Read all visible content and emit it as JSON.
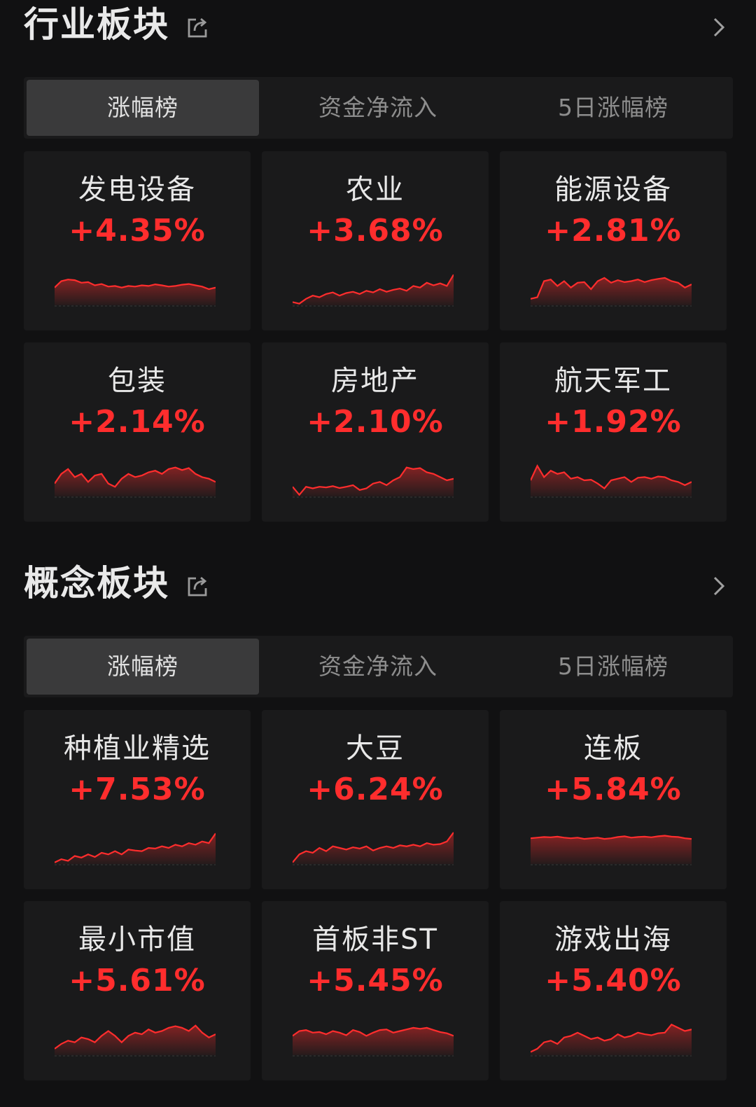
{
  "colors": {
    "background": "#111112",
    "card": "#1a1a1b",
    "active_tab": "#3a3a3b",
    "up": "#ff2d2d"
  },
  "industry": {
    "title": "行业板块",
    "tabs": [
      {
        "label": "涨幅榜",
        "active": true
      },
      {
        "label": "资金净流入",
        "active": false
      },
      {
        "label": "5日涨幅榜",
        "active": false
      }
    ],
    "cards": [
      {
        "name": "发电设备",
        "change": "+4.35%",
        "trend": [
          0.55,
          0.75,
          0.8,
          0.78,
          0.7,
          0.72,
          0.62,
          0.66,
          0.58,
          0.6,
          0.55,
          0.6,
          0.58,
          0.62,
          0.6,
          0.65,
          0.62,
          0.58,
          0.6,
          0.64,
          0.66,
          0.62,
          0.58,
          0.5,
          0.55
        ]
      },
      {
        "name": "农业",
        "change": "+3.68%",
        "trend": [
          0.1,
          0.05,
          0.2,
          0.3,
          0.25,
          0.35,
          0.4,
          0.3,
          0.38,
          0.42,
          0.35,
          0.45,
          0.4,
          0.5,
          0.42,
          0.48,
          0.52,
          0.45,
          0.6,
          0.55,
          0.7,
          0.62,
          0.68,
          0.6,
          0.95
        ]
      },
      {
        "name": "能源设备",
        "change": "+2.81%",
        "trend": [
          0.2,
          0.25,
          0.75,
          0.8,
          0.6,
          0.75,
          0.55,
          0.7,
          0.72,
          0.5,
          0.75,
          0.85,
          0.7,
          0.78,
          0.72,
          0.75,
          0.8,
          0.72,
          0.78,
          0.82,
          0.85,
          0.75,
          0.7,
          0.55,
          0.65
        ]
      },
      {
        "name": "包装",
        "change": "+2.14%",
        "trend": [
          0.4,
          0.7,
          0.85,
          0.6,
          0.7,
          0.45,
          0.65,
          0.7,
          0.4,
          0.3,
          0.55,
          0.7,
          0.6,
          0.65,
          0.75,
          0.8,
          0.7,
          0.85,
          0.9,
          0.82,
          0.88,
          0.7,
          0.6,
          0.55,
          0.45
        ]
      },
      {
        "name": "房地产",
        "change": "+2.10%",
        "trend": [
          0.3,
          0.05,
          0.3,
          0.25,
          0.3,
          0.28,
          0.32,
          0.26,
          0.3,
          0.35,
          0.2,
          0.25,
          0.4,
          0.45,
          0.35,
          0.5,
          0.6,
          0.9,
          0.85,
          0.88,
          0.75,
          0.7,
          0.6,
          0.5,
          0.55
        ]
      },
      {
        "name": "航天军工",
        "change": "+1.92%",
        "trend": [
          0.5,
          0.95,
          0.6,
          0.8,
          0.7,
          0.75,
          0.55,
          0.6,
          0.5,
          0.52,
          0.4,
          0.25,
          0.5,
          0.55,
          0.6,
          0.45,
          0.58,
          0.6,
          0.55,
          0.62,
          0.6,
          0.5,
          0.45,
          0.35,
          0.45
        ]
      }
    ]
  },
  "concept": {
    "title": "概念板块",
    "tabs": [
      {
        "label": "涨幅榜",
        "active": true
      },
      {
        "label": "资金净流入",
        "active": false
      },
      {
        "label": "5日涨幅榜",
        "active": false
      }
    ],
    "cards": [
      {
        "name": "种植业精选",
        "change": "+7.53%",
        "trend": [
          0.05,
          0.15,
          0.1,
          0.25,
          0.2,
          0.3,
          0.22,
          0.35,
          0.3,
          0.4,
          0.3,
          0.45,
          0.42,
          0.4,
          0.5,
          0.48,
          0.55,
          0.5,
          0.6,
          0.55,
          0.65,
          0.6,
          0.7,
          0.65,
          0.95
        ]
      },
      {
        "name": "大豆",
        "change": "+6.24%",
        "trend": [
          0.05,
          0.3,
          0.4,
          0.35,
          0.5,
          0.4,
          0.55,
          0.5,
          0.45,
          0.52,
          0.48,
          0.55,
          0.42,
          0.5,
          0.55,
          0.5,
          0.58,
          0.55,
          0.6,
          0.55,
          0.65,
          0.6,
          0.62,
          0.7,
          0.98
        ]
      },
      {
        "name": "连板",
        "change": "+5.84%",
        "trend": [
          0.8,
          0.82,
          0.84,
          0.83,
          0.85,
          0.82,
          0.8,
          0.82,
          0.78,
          0.8,
          0.82,
          0.78,
          0.8,
          0.84,
          0.86,
          0.82,
          0.84,
          0.85,
          0.83,
          0.86,
          0.88,
          0.85,
          0.84,
          0.8,
          0.78
        ]
      },
      {
        "name": "最小市值",
        "change": "+5.61%",
        "trend": [
          0.2,
          0.35,
          0.45,
          0.4,
          0.55,
          0.5,
          0.4,
          0.6,
          0.75,
          0.6,
          0.4,
          0.6,
          0.7,
          0.65,
          0.8,
          0.7,
          0.75,
          0.85,
          0.9,
          0.85,
          0.75,
          0.92,
          0.7,
          0.55,
          0.65
        ]
      },
      {
        "name": "首板非ST",
        "change": "+5.45%",
        "trend": [
          0.6,
          0.75,
          0.78,
          0.7,
          0.72,
          0.65,
          0.75,
          0.7,
          0.62,
          0.78,
          0.72,
          0.6,
          0.7,
          0.78,
          0.8,
          0.7,
          0.75,
          0.8,
          0.85,
          0.82,
          0.85,
          0.78,
          0.72,
          0.68,
          0.6
        ]
      },
      {
        "name": "游戏出海",
        "change": "+5.40%",
        "trend": [
          0.1,
          0.2,
          0.4,
          0.45,
          0.35,
          0.55,
          0.6,
          0.7,
          0.6,
          0.5,
          0.55,
          0.45,
          0.5,
          0.65,
          0.55,
          0.6,
          0.7,
          0.65,
          0.62,
          0.68,
          0.7,
          0.95,
          0.85,
          0.75,
          0.8
        ]
      }
    ]
  }
}
